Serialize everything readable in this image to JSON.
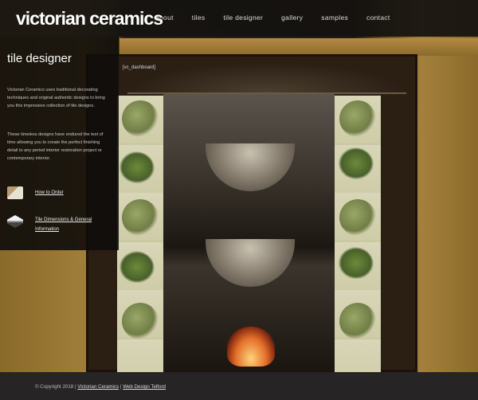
{
  "header": {
    "logo": "victorian ceramics",
    "nav": [
      "about",
      "tiles",
      "tile designer",
      "gallery",
      "samples",
      "contact"
    ]
  },
  "sidebar": {
    "title": "tile designer",
    "paragraph1": "Victorian Ceramics uses traditional decorating techniques and original authentic designs to bring you this impressive collection of tile designs.",
    "paragraph2": "These timeless designs have endured the test of time allowing you to create the perfect finishing detail to any period interior restoration project or contemporary interior.",
    "links": [
      {
        "label": "How to Order",
        "icon": "order-icon"
      },
      {
        "label": "Tile Dimensions & General Information",
        "icon": "tile-dimensions-icon"
      }
    ]
  },
  "main": {
    "shortcode": "[vc_dashboard]"
  },
  "footer": {
    "copyright": "© Copyright 2018 |",
    "link1": "Victorian Ceramics",
    "separator": "|",
    "link2": "Web Design Telford"
  }
}
